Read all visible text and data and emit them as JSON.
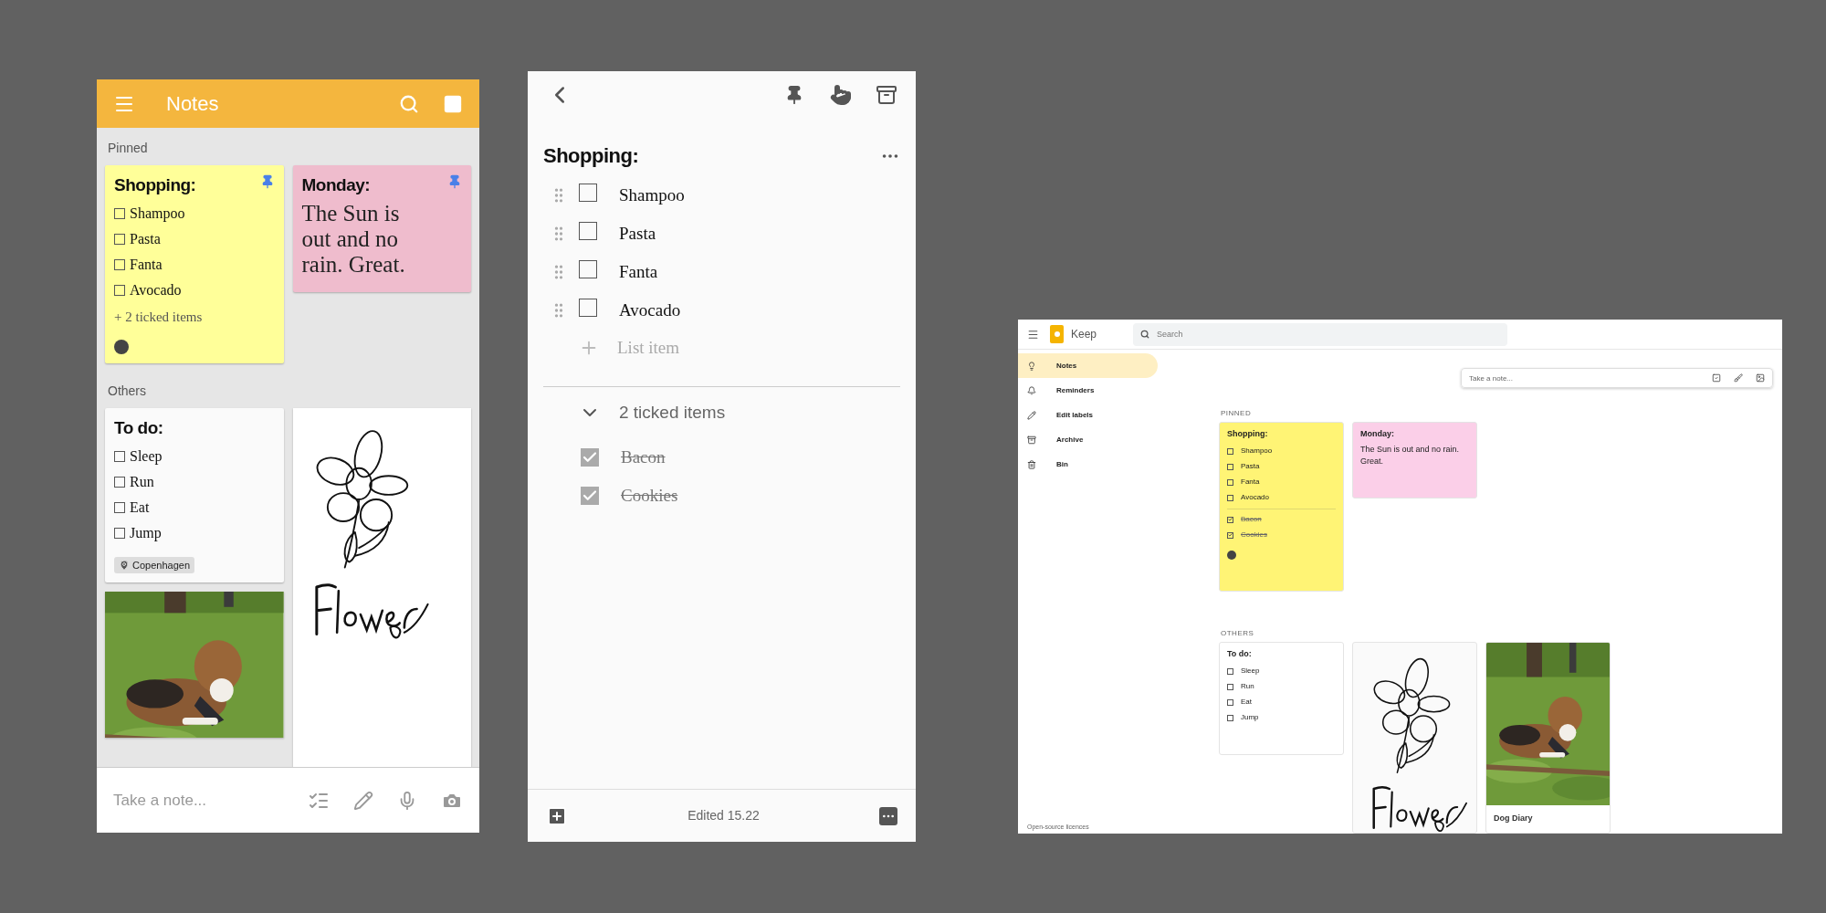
{
  "mobile_list": {
    "title": "Notes",
    "pinned_heading": "Pinned",
    "pinned": [
      {
        "kind": "checklist",
        "title": "Shopping:",
        "pinned": true,
        "color": "#ffff99",
        "items": [
          {
            "text": "Shampoo",
            "checked": false
          },
          {
            "text": "Pasta",
            "checked": false
          },
          {
            "text": "Fanta",
            "checked": false
          },
          {
            "text": "Avocado",
            "checked": false
          }
        ],
        "ticked_summary": "+ 2 ticked items",
        "avatar": true
      },
      {
        "kind": "text",
        "title": "Monday:",
        "pinned": true,
        "color": "#efbccd",
        "body": "The Sun is out and no rain. Great."
      }
    ],
    "others_heading": "Others",
    "others": [
      {
        "kind": "checklist",
        "title": "To do:",
        "pinned": false,
        "color": "#fafafa",
        "items": [
          {
            "text": "Sleep",
            "checked": false
          },
          {
            "text": "Run",
            "checked": false
          },
          {
            "text": "Eat",
            "checked": false
          },
          {
            "text": "Jump",
            "checked": false
          }
        ],
        "location": "Copenhagen"
      },
      {
        "kind": "drawing"
      },
      {
        "kind": "picture"
      }
    ],
    "take_note_placeholder": "Take a note..."
  },
  "mobile_editor": {
    "title": "Shopping:",
    "items": [
      {
        "text": "Shampoo",
        "checked": false
      },
      {
        "text": "Pasta",
        "checked": false
      },
      {
        "text": "Fanta",
        "checked": false
      },
      {
        "text": "Avocado",
        "checked": false
      }
    ],
    "add_placeholder": "List item",
    "ticked_toggle": {
      "label": "2 ticked items",
      "expanded": true
    },
    "ticked": [
      {
        "text": "Bacon",
        "checked": true
      },
      {
        "text": "Cookies",
        "checked": true
      }
    ],
    "status": "Edited 15.22"
  },
  "desktop": {
    "app_name": "Keep",
    "search_placeholder": "Search",
    "sidebar": [
      {
        "label": "Notes",
        "selected": true
      },
      {
        "label": "Reminders",
        "selected": false
      },
      {
        "label": "Edit labels",
        "selected": false
      },
      {
        "label": "Archive",
        "selected": false
      },
      {
        "label": "Bin",
        "selected": false
      }
    ],
    "footer_link": "Open-source licences",
    "take_note_placeholder": "Take a note...",
    "pinned_heading": "PINNED",
    "pinned": [
      {
        "kind": "checklist",
        "title": "Shopping:",
        "color": "#fff475",
        "items": [
          {
            "text": "Shampoo",
            "checked": false
          },
          {
            "text": "Pasta",
            "checked": false
          },
          {
            "text": "Fanta",
            "checked": false
          },
          {
            "text": "Avocado",
            "checked": false
          }
        ],
        "ticked": [
          {
            "text": "Bacon",
            "checked": true
          },
          {
            "text": "Cookies",
            "checked": true
          }
        ],
        "avatar": true
      },
      {
        "kind": "text",
        "title": "Monday:",
        "color": "#fbcfe8",
        "body": "The Sun is out and no rain. Great."
      }
    ],
    "others_heading": "OTHERS",
    "others": [
      {
        "kind": "checklist",
        "title": "To do:",
        "color": "#ffffff",
        "items": [
          {
            "text": "Sleep",
            "checked": false
          },
          {
            "text": "Run",
            "checked": false
          },
          {
            "text": "Eat",
            "checked": false
          },
          {
            "text": "Jump",
            "checked": false
          }
        ]
      },
      {
        "kind": "drawing"
      },
      {
        "kind": "picture",
        "caption": "Dog Diary"
      }
    ]
  }
}
